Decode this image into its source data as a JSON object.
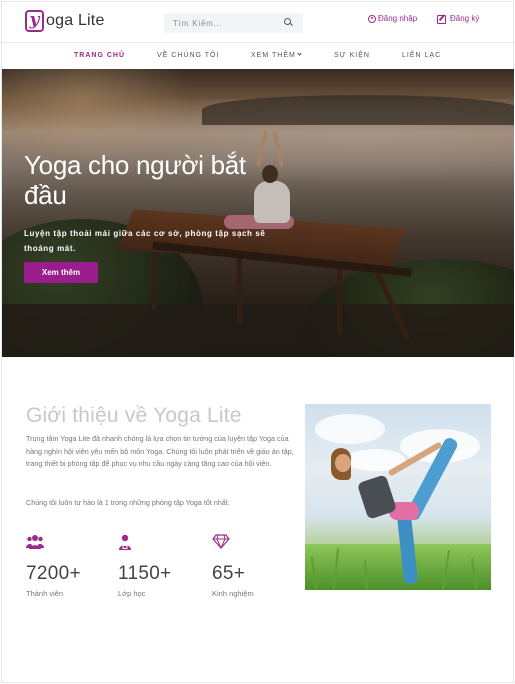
{
  "brand": {
    "logo_letter": "y",
    "name": "oga Lite",
    "accent": "#9b2a8a"
  },
  "search": {
    "placeholder": "Tìm Kiếm..."
  },
  "auth": {
    "login": "Đăng nhập",
    "register": "Đăng ký"
  },
  "nav": {
    "items": [
      {
        "label": "TRANG CHỦ",
        "active": true
      },
      {
        "label": "VỀ CHÚNG TÔI",
        "active": false
      },
      {
        "label": "XEM THÊM",
        "active": false
      },
      {
        "label": "SỰ KIỆN",
        "active": false
      },
      {
        "label": "LIÊN LẠC",
        "active": false
      }
    ]
  },
  "hero": {
    "title": "Yoga cho người bắt đầu",
    "subtitle": "Luyện tập thoải mái giữa các cơ sở, phòng tập sạch sẽ thoáng mát.",
    "button": "Xem thêm",
    "button_color": "#9b1d8d"
  },
  "about": {
    "title": "Giới thiệu về Yoga Lite",
    "p1": "Trung tâm Yoga Lite đã nhanh chóng là lựa chọn tin tưởng của luyện tập Yoga của hàng nghìn hội viên yêu mến bộ môn Yoga. Chúng tôi luôn phát triển về giáo án tập, trang thiết bị phòng tập để phục vụ nhu cầu ngày càng tăng cao của hội viên.",
    "p2": "Chúng tôi luôn tự hào là 1 trong những phòng tập Yoga tốt nhất.",
    "stats": [
      {
        "icon": "users-icon",
        "value": "7200+",
        "label": "Thành viên"
      },
      {
        "icon": "teacher-icon",
        "value": "1150+",
        "label": "Lớp học"
      },
      {
        "icon": "diamond-icon",
        "value": "65+",
        "label": "Kinh nghiệm"
      }
    ]
  }
}
